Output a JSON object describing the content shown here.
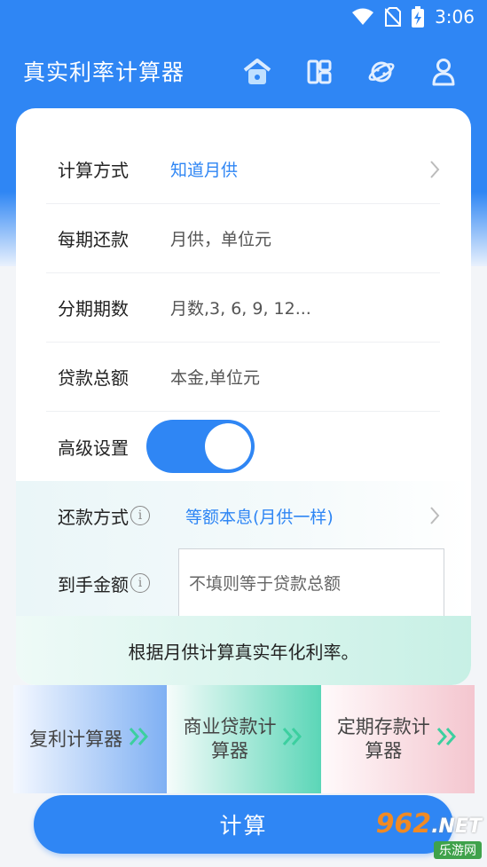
{
  "status": {
    "time": "3:06"
  },
  "app": {
    "title": "真实利率计算器"
  },
  "top_icons": [
    "home-icon",
    "grid-icon",
    "planet-icon",
    "user-icon"
  ],
  "form": {
    "calc_method": {
      "label": "计算方式",
      "value": "知道月供"
    },
    "payment": {
      "label": "每期还款",
      "placeholder": "月供，单位元"
    },
    "periods": {
      "label": "分期期数",
      "placeholder": "月数,3, 6, 9, 12..."
    },
    "principal": {
      "label": "贷款总额",
      "placeholder": "本金,单位元"
    },
    "advanced": {
      "label": "高级设置",
      "enabled": true
    },
    "repay_method": {
      "label": "还款方式",
      "value": "等额本息(月供一样)"
    },
    "arrival_amount": {
      "label": "到手金额",
      "placeholder": "不填则等于贷款总额"
    }
  },
  "hint": "根据月供计算真实年化利率。",
  "calculators": [
    {
      "label": "复利计算器"
    },
    {
      "label": "商业贷款计\n算器"
    },
    {
      "label": "定期存款计\n算器"
    }
  ],
  "calc_button": "计算",
  "watermark": {
    "top": "962",
    "net": ".NET",
    "bottom": "乐游网"
  },
  "colors": {
    "primary": "#2f86f4",
    "accent_green": "#3ccf9f"
  }
}
